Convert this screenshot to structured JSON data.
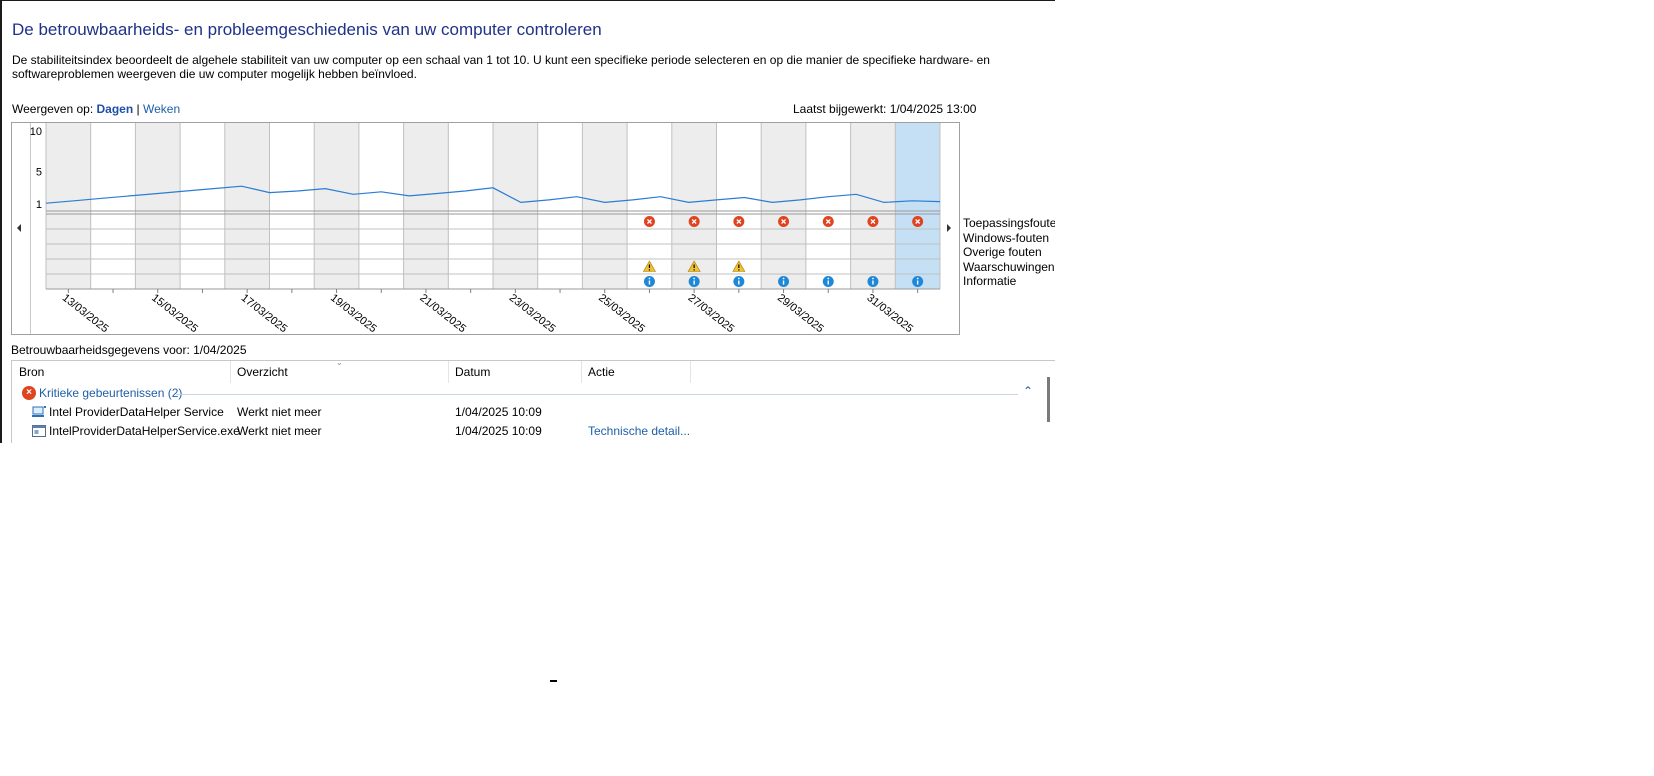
{
  "header": {
    "title": "De betrouwbaarheids- en probleemgeschiedenis van uw computer controleren",
    "description": "De stabiliteitsindex beoordeelt de algehele stabiliteit van uw computer op een schaal van 1 tot 10. U kunt een specifieke periode selecteren en op die manier de specifieke hardware- en softwareproblemen weergeven die uw computer mogelijk hebben beïnvloed."
  },
  "view_by": {
    "label": "Weergeven op:",
    "days": "Dagen",
    "separator": "|",
    "weeks": "Weken",
    "active": "days"
  },
  "last_updated": "Laatst bijgewerkt: 1/04/2025 13:00",
  "chart_data": {
    "type": "line",
    "title": "",
    "ylabel": "",
    "ylim": [
      1,
      10
    ],
    "y_ticks": [
      "10",
      "5",
      "1"
    ],
    "x_tick_labels": [
      "13/03/2025",
      "15/03/2025",
      "17/03/2025",
      "19/03/2025",
      "21/03/2025",
      "23/03/2025",
      "25/03/2025",
      "27/03/2025",
      "29/03/2025",
      "31/03/2025"
    ],
    "series": [
      {
        "values": [
          1.1,
          1.4,
          1.7,
          2.0,
          2.3,
          2.6,
          2.9,
          3.2,
          2.4,
          2.6,
          2.9,
          2.2,
          2.5,
          2.0,
          2.3,
          2.6,
          3.0,
          1.2,
          1.5,
          1.9,
          1.2,
          1.5,
          1.9,
          1.2,
          1.5,
          1.8,
          1.2,
          1.5,
          1.9,
          2.2,
          1.2,
          1.4,
          1.3
        ]
      }
    ],
    "event_rows": [
      "Toepassingsfouten",
      "Windows-fouten",
      "Overige fouten",
      "Waarschuwingen",
      "Informatie"
    ],
    "app_errors_columns": [
      13,
      14,
      15,
      16,
      17,
      18,
      19
    ],
    "warnings_columns": [
      13,
      14,
      15
    ],
    "info_columns": [
      13,
      14,
      15,
      16,
      17,
      18,
      19
    ],
    "selected_column": 19,
    "total_columns": 20,
    "colors": {
      "line": "#2b7cd3",
      "weekend_band": "#ededed",
      "selected_band": "#c5dff5",
      "error": "#e0431f",
      "warning": "#f2c12e",
      "info": "#1e88d8"
    }
  },
  "details": {
    "title": "Betrouwbaarheidsgegevens voor: 1/04/2025",
    "columns": [
      "Bron",
      "Overzicht",
      "Datum",
      "Actie"
    ],
    "group": {
      "label": "Kritieke gebeurtenissen (2)",
      "collapse_icon": "chevron-up-icon"
    },
    "rows": [
      {
        "icon": "computer-icon",
        "source": "Intel ProviderDataHelper Service",
        "summary": "Werkt niet meer",
        "date": "1/04/2025 10:09",
        "action": ""
      },
      {
        "icon": "application-icon",
        "source": "IntelProviderDataHelperService.exe",
        "summary": "Werkt niet meer",
        "date": "1/04/2025 10:09",
        "action": "Technische detail..."
      }
    ]
  }
}
